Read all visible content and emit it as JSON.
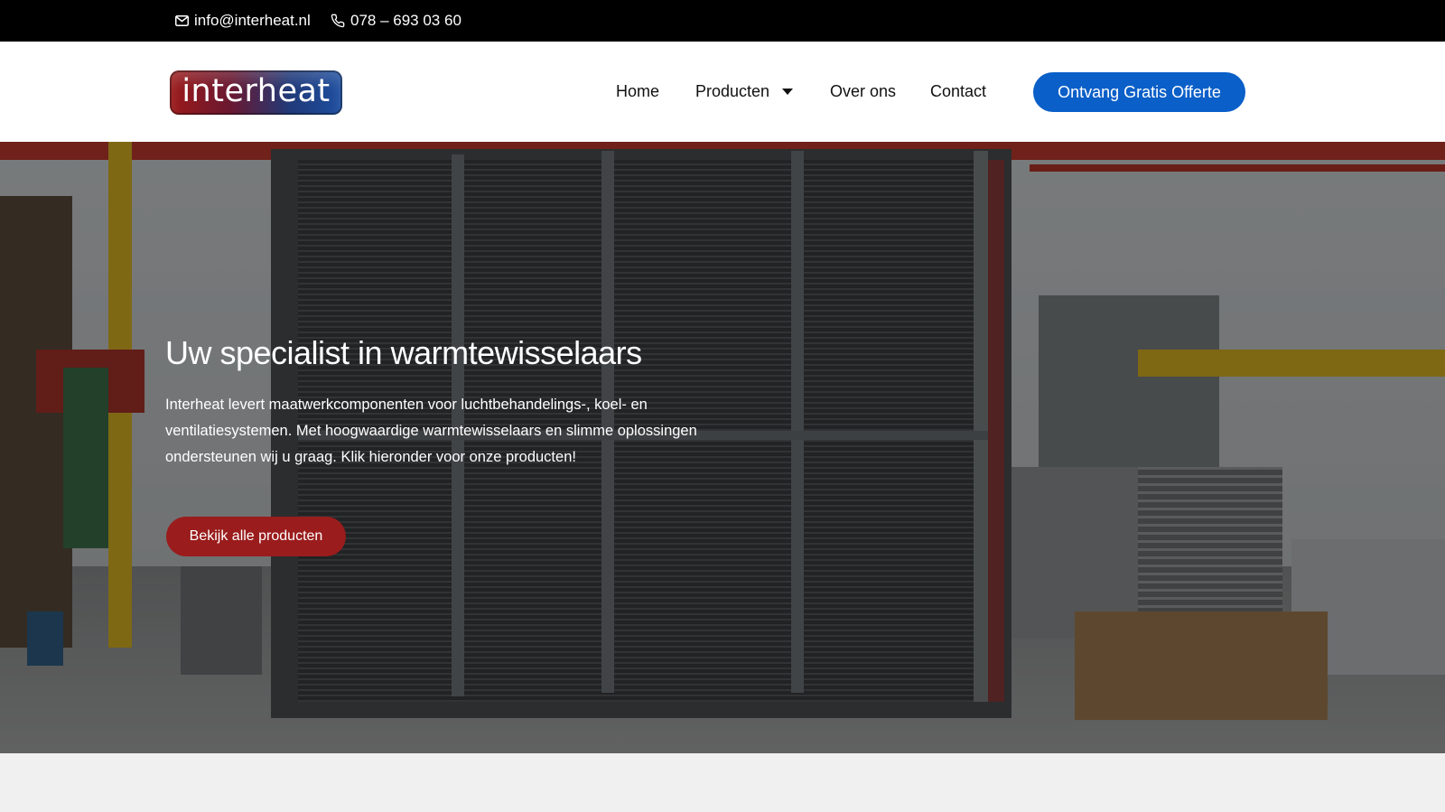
{
  "topbar": {
    "email": "info@interheat.nl",
    "phone": "078 – 693 03 60",
    "email_icon": "envelope-icon",
    "phone_icon": "phone-icon"
  },
  "header": {
    "logo_text": "interheat",
    "nav": {
      "home": "Home",
      "producten": "Producten",
      "over_ons": "Over ons",
      "contact": "Contact"
    },
    "cta_label": "Ontvang Gratis Offerte"
  },
  "hero": {
    "title": "Uw specialist in warmtewisselaars",
    "text": "Interheat levert maatwerkcomponenten voor luchtbehandelings-, koel- en ventilatiesystemen. Met hoogwaardige warmtewisselaars en slimme oplossingen ondersteunen wij u graag. Klik hieronder voor onze producten!",
    "button_label": "Bekijk alle producten"
  },
  "colors": {
    "topbar_bg": "#000000",
    "cta_blue": "#0a5fc8",
    "hero_button_red": "#9a1c1c",
    "page_bg": "#f0f0f0"
  }
}
